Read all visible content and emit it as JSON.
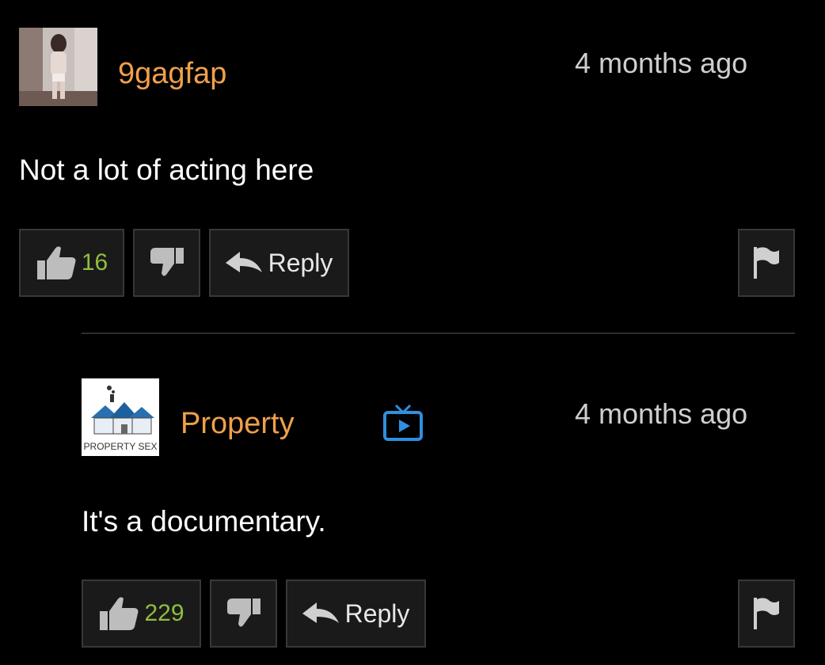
{
  "comments": [
    {
      "username": "9gagfap",
      "timestamp": "4 months ago",
      "text": "Not a lot of acting here",
      "likes": "16",
      "reply_label": "Reply"
    },
    {
      "username": "Property",
      "timestamp": "4 months ago",
      "text": "It's a documentary.",
      "likes": "229",
      "reply_label": "Reply",
      "avatar_text": "PROPERTY SEX"
    }
  ],
  "icons": {
    "like": "thumbs-up-icon",
    "dislike": "thumbs-down-icon",
    "reply": "reply-arrow-icon",
    "flag": "flag-icon",
    "verified": "tv-icon"
  },
  "colors": {
    "background": "#000000",
    "username": "#f0a04b",
    "like_count": "#8fbf3f",
    "button_bg": "#1a1a1a",
    "button_border": "#383838",
    "verified_icon": "#2f8fe0"
  }
}
